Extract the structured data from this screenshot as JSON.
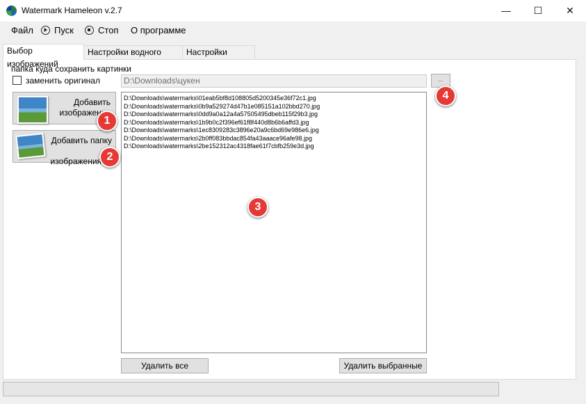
{
  "window": {
    "title": "Watermark Hameleon v.2.7",
    "minimize_glyph": "—",
    "maximize_glyph": "☐",
    "close_glyph": "✕"
  },
  "menu": {
    "file": "Файл",
    "start": "Пуск",
    "stop": "Стоп",
    "about": "О программе"
  },
  "tabs": [
    "Выбор изображений",
    "Настройки водного знака",
    "Настройки сжатия"
  ],
  "panel": {
    "save_folder_label": "папка куда сохранить картинки",
    "replace_original_label": "заменить оригинал",
    "replace_original_checked": false,
    "output_path": "D:\\Downloads\\цукен",
    "browse_label": "...",
    "add_images_label": "Добавить изображения",
    "add_folder_label": "Добавить папку с изображениями",
    "files": [
      "D:\\Downloads\\watermarks\\01eab5bf8d108805d5200345e36f72c1.jpg",
      "D:\\Downloads\\watermarks\\0b9a529274d47b1e085151a102bbd270.jpg",
      "D:\\Downloads\\watermarks\\0dd9a0a12a4a57505495dbeb115f29b3.jpg",
      "D:\\Downloads\\watermarks\\1b9b0c2f396ef61f8f440d8b6b6affd3.jpg",
      "D:\\Downloads\\watermarks\\1ec8309283c3896e20a9c6bd69e986e6.jpg",
      "D:\\Downloads\\watermarks\\2b0ff083bbdac854fa43aaace96afe98.jpg",
      "D:\\Downloads\\watermarks\\2be152312ac4318fae61f7cbfb259e3d.jpg"
    ],
    "delete_all_label": "Удалить все",
    "delete_selected_label": "Удалить выбранные"
  },
  "badges": [
    "1",
    "2",
    "3",
    "4"
  ],
  "colors": {
    "badge": "#e53935",
    "window_bg": "#f0f0f0",
    "panel_bg": "#ffffff"
  }
}
